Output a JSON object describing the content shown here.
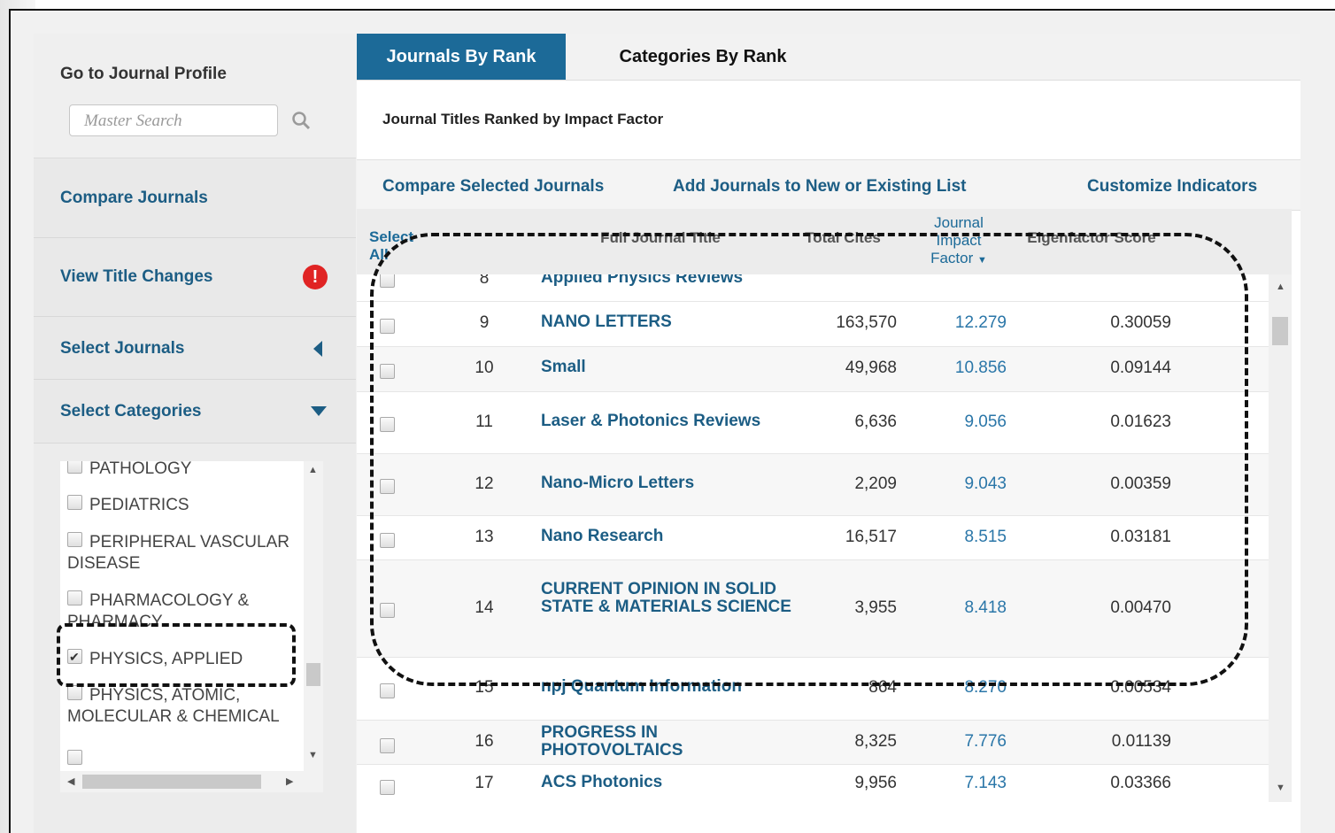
{
  "sidebar": {
    "profile_title": "Go to Journal Profile",
    "search_placeholder": "Master Search",
    "items": [
      {
        "label": "Compare Journals"
      },
      {
        "label": "View Title Changes",
        "badge": "!"
      },
      {
        "label": "Select Journals"
      },
      {
        "label": "Select Categories"
      }
    ],
    "categories": [
      {
        "label": "PATHOLOGY",
        "checked": false
      },
      {
        "label": "PEDIATRICS",
        "checked": false
      },
      {
        "label": "PERIPHERAL VASCULAR DISEASE",
        "checked": false
      },
      {
        "label": "PHARMACOLOGY & PHARMACY",
        "checked": false
      },
      {
        "label": "PHYSICS, APPLIED",
        "checked": true
      },
      {
        "label": "PHYSICS, ATOMIC, MOLECULAR & CHEMICAL",
        "checked": false
      }
    ]
  },
  "tabs": [
    {
      "label": "Journals By Rank",
      "active": true
    },
    {
      "label": "Categories By Rank",
      "active": false
    }
  ],
  "main": {
    "subtitle": "Journal Titles Ranked by Impact Factor",
    "actions": {
      "compare": "Compare Selected Journals",
      "add_list": "Add Journals to New or Existing List",
      "customize": "Customize Indicators"
    }
  },
  "table": {
    "headers": {
      "select_all": "Select All",
      "title": "Full Journal Title",
      "total_cites": "Total Cites",
      "jif": "Journal Impact Factor",
      "eigen": "Eigenfactor Score"
    },
    "partial_row": {
      "rank": "8",
      "title": "Applied Physics Reviews"
    },
    "rows": [
      {
        "rank": "9",
        "title": "NANO LETTERS",
        "cites": "163,570",
        "jif": "12.279",
        "eigen": "0.30059"
      },
      {
        "rank": "10",
        "title": "Small",
        "cites": "49,968",
        "jif": "10.856",
        "eigen": "0.09144"
      },
      {
        "rank": "11",
        "title": "Laser & Photonics Reviews",
        "cites": "6,636",
        "jif": "9.056",
        "eigen": "0.01623"
      },
      {
        "rank": "12",
        "title": "Nano-Micro Letters",
        "cites": "2,209",
        "jif": "9.043",
        "eigen": "0.00359"
      },
      {
        "rank": "13",
        "title": "Nano Research",
        "cites": "16,517",
        "jif": "8.515",
        "eigen": "0.03181"
      },
      {
        "rank": "14",
        "title": "CURRENT OPINION IN SOLID STATE & MATERIALS SCIENCE",
        "cites": "3,955",
        "jif": "8.418",
        "eigen": "0.00470"
      },
      {
        "rank": "15",
        "title": "npj Quantum Information",
        "cites": "864",
        "jif": "8.270",
        "eigen": "0.00534"
      },
      {
        "rank": "16",
        "title": "PROGRESS IN PHOTOVOLTAICS",
        "cites": "8,325",
        "jif": "7.776",
        "eigen": "0.01139"
      },
      {
        "rank": "17",
        "title": "ACS Photonics",
        "cites": "9,956",
        "jif": "7.143",
        "eigen": "0.03366"
      }
    ]
  },
  "colors": {
    "accent": "#1c6a98",
    "link": "#1c5d84",
    "alert": "#e02424"
  }
}
